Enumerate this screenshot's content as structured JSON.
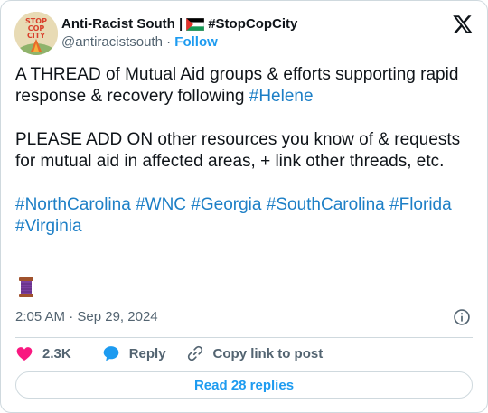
{
  "author": {
    "display_name": "Anti-Racist South |",
    "display_name_suffix": "#StopCopCity",
    "handle": "@antiracistsouth",
    "separator": "·",
    "follow_label": "Follow",
    "avatar_icon": "stop-cop-city-avatar-icon"
  },
  "tweet": {
    "para1_text": "A THREAD of Mutual Aid groups & efforts supporting rapid response & recovery following ",
    "para1_tag": "#Helene",
    "para2_text": "PLEASE ADD ON other resources you know of & requests for mutual aid in affected areas, + link other threads, etc.",
    "hashtags": [
      "#NorthCarolina",
      "#WNC",
      "#Georgia",
      "#SouthCarolina",
      "#Florida",
      "#Virginia"
    ],
    "emoji_icon": "thread-spool-icon"
  },
  "meta": {
    "time": "2:05 AM",
    "separator": "·",
    "date": "Sep 29, 2024"
  },
  "actions": {
    "likes": "2.3K",
    "reply_label": "Reply",
    "copy_label": "Copy link to post"
  },
  "read_replies_label": "Read 28 replies",
  "colors": {
    "link": "#1d9bf0",
    "hashtag": "#1d7fc6",
    "heart": "#f91880",
    "muted": "#536471",
    "border": "#cfd9de"
  }
}
